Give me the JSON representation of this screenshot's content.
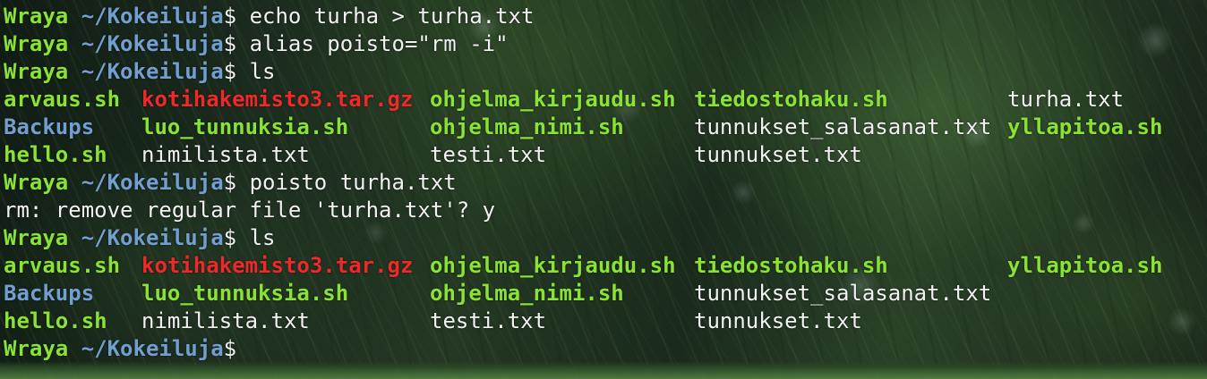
{
  "prompt": {
    "user": "Wraya",
    "path": "~/Kokeiluja",
    "symbol": "$"
  },
  "commands": [
    "echo turha > turha.txt",
    "alias poisto=\"rm -i\"",
    "ls",
    "poisto turha.txt",
    "ls",
    ""
  ],
  "rm_confirmation": "rm: remove regular file 'turha.txt'? y",
  "ls_output_1": [
    [
      "arvaus.sh",
      "kotihakemisto3.tar.gz",
      "ohjelma_kirjaudu.sh",
      "tiedostohaku.sh",
      "turha.txt"
    ],
    [
      "Backups",
      "luo_tunnuksia.sh",
      "ohjelma_nimi.sh",
      "tunnukset_salasanat.txt",
      "yllapitoa.sh"
    ],
    [
      "hello.sh",
      "nimilista.txt",
      "testi.txt",
      "tunnukset.txt",
      ""
    ]
  ],
  "ls_output_2": [
    [
      "arvaus.sh",
      "kotihakemisto3.tar.gz",
      "ohjelma_kirjaudu.sh",
      "tiedostohaku.sh",
      "yllapitoa.sh"
    ],
    [
      "Backups",
      "luo_tunnuksia.sh",
      "ohjelma_nimi.sh",
      "tunnukset_salasanat.txt",
      ""
    ],
    [
      "hello.sh",
      "nimilista.txt",
      "testi.txt",
      "tunnukset.txt",
      ""
    ]
  ],
  "colors": {
    "executable": "#8ae234",
    "directory": "#729fcf",
    "archive": "#ef2929",
    "plain": "#f2f2f2"
  }
}
